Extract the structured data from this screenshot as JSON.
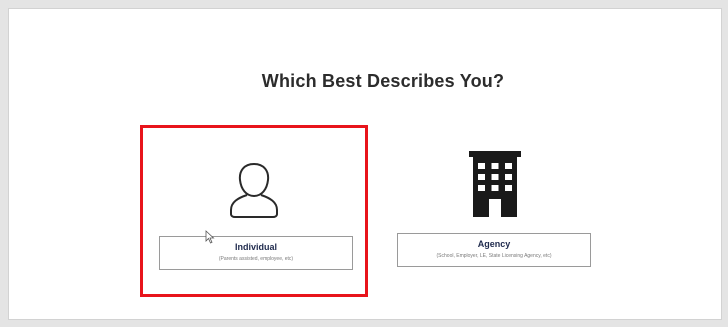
{
  "heading": "Which Best Describes You?",
  "options": [
    {
      "name": "Individual",
      "description": "(Parents assisted, employee, etc)",
      "icon": "person-icon",
      "selected": true
    },
    {
      "name": "Agency",
      "description": "(School, Employer, LE, State Licensing Agency, etc)",
      "icon": "building-icon",
      "selected": false
    }
  ],
  "colors": {
    "selection_border": "#e8141b",
    "heading": "#2c2c2c",
    "label_name": "#1f2a4d"
  }
}
